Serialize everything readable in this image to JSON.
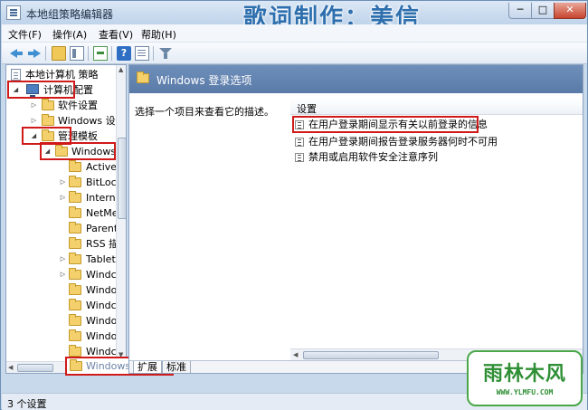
{
  "window": {
    "title": "本地组策略编辑器",
    "watermark_title": "歌词制作：美信",
    "controls": {
      "minimize": "─",
      "maximize": "□",
      "close": "✕"
    }
  },
  "menu": [
    {
      "label": "文件(F)"
    },
    {
      "label": "操作(A)"
    },
    {
      "label": "查看(V)"
    },
    {
      "label": "帮助(H)"
    }
  ],
  "toolbar": {
    "icons": [
      "back-arrow-icon",
      "forward-arrow-icon",
      "folder-up-icon",
      "show-hide-tree-icon",
      "export-list-icon",
      "help-icon",
      "properties-icon",
      "filter-icon"
    ]
  },
  "tree": {
    "root": "本地计算机 策略",
    "computer_config": "计算机配置",
    "software_settings": "软件设置",
    "windows_settings": "Windows 设",
    "admin_templates": "管理模板",
    "windows_components": "Windows",
    "children": [
      {
        "label": "Active"
      },
      {
        "label": "BitLoc"
      },
      {
        "label": "Intern"
      },
      {
        "label": "NetMe"
      },
      {
        "label": "Parent"
      },
      {
        "label": "RSS 描"
      },
      {
        "label": "Tablet"
      },
      {
        "label": "Windc"
      },
      {
        "label": "Windo"
      },
      {
        "label": "Windc"
      },
      {
        "label": "Windo"
      },
      {
        "label": "Windo"
      },
      {
        "label": "Windc"
      }
    ],
    "selected": "Windows 登录选项"
  },
  "right": {
    "header_title": "Windows 登录选项",
    "description": "选择一个项目来查看它的描述。",
    "column_header": "设置",
    "settings": [
      {
        "label": "在用户登录期间显示有关以前登录的信息"
      },
      {
        "label": "在用户登录期间报告登录服务器何时不可用"
      },
      {
        "label": "禁用或启用软件安全注意序列"
      }
    ],
    "tabs": [
      {
        "label": "扩展"
      },
      {
        "label": "标准"
      }
    ]
  },
  "status": {
    "text": "3 个设置"
  },
  "logo": {
    "main": "雨林木风",
    "url": "WWW.YLMFU.COM"
  },
  "colors": {
    "highlight_border": "#d01a1a",
    "header_blue": "#5a7aa7",
    "logo_green": "#2f8f35"
  }
}
